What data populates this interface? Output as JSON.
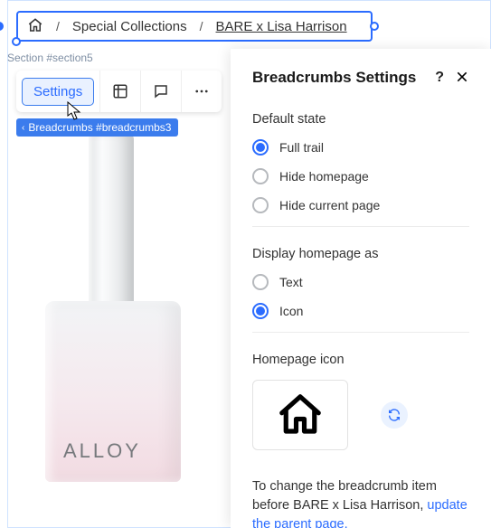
{
  "breadcrumb": {
    "home_icon": "home",
    "items": [
      "Special Collections",
      "BARE x Lisa Harrison"
    ]
  },
  "section_label": "Section #section5",
  "toolbar": {
    "settings_label": "Settings"
  },
  "element_tag": "Breadcrumbs #breadcrumbs3",
  "product": {
    "brand_fragment": "ALLOY"
  },
  "panel": {
    "title": "Breadcrumbs Settings",
    "group1_label": "Default state",
    "group1_options": [
      {
        "label": "Full trail",
        "checked": true
      },
      {
        "label": "Hide homepage",
        "checked": false
      },
      {
        "label": "Hide current page",
        "checked": false
      }
    ],
    "group2_label": "Display homepage as",
    "group2_options": [
      {
        "label": "Text",
        "checked": false
      },
      {
        "label": "Icon",
        "checked": true
      }
    ],
    "icon_section_label": "Homepage icon",
    "helper_text_1": "To change the breadcrumb item before BARE x Lisa Harrison, ",
    "helper_link": "update the parent page.",
    "helper_text_2": ""
  }
}
